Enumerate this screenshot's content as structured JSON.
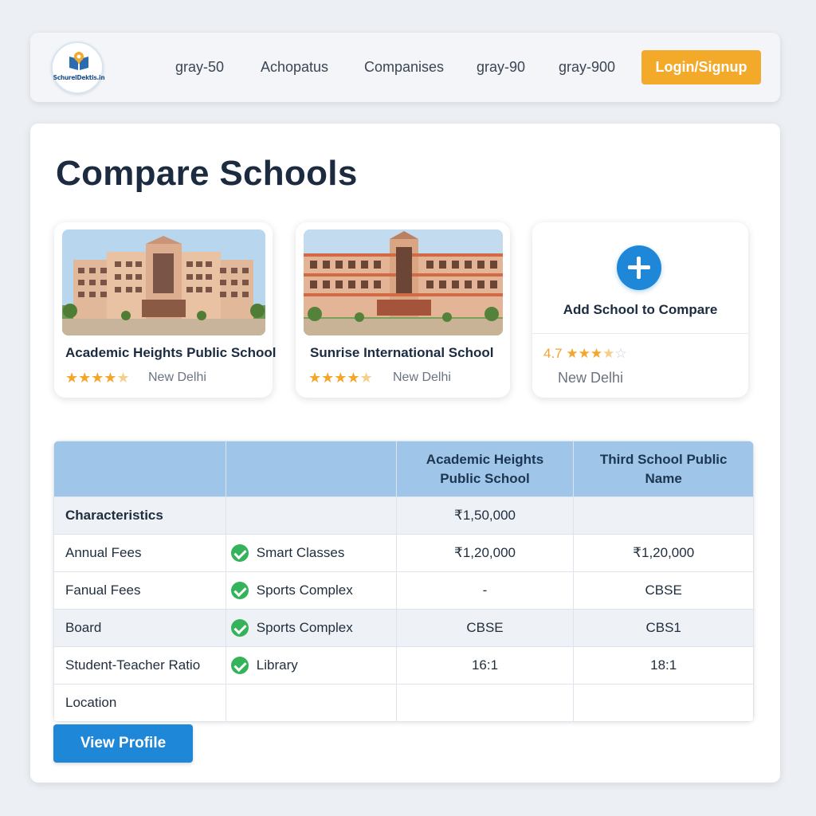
{
  "header": {
    "logo_text": "SchurelDektis.in",
    "nav": [
      "gray-50",
      "Achopatus",
      "Companises",
      "gray-90",
      "gray-900"
    ],
    "login_label": "Login/Signup",
    "accent_color": "#f3a929"
  },
  "page": {
    "title": "Compare Schools"
  },
  "schools": [
    {
      "name": "Academic Heights Public School",
      "stars": "★★★★",
      "half_star": "★",
      "rating_value": 4.5,
      "city": "New Delhi",
      "icon": "building-photo"
    },
    {
      "name": "Sunrise International School",
      "stars": "★★★★",
      "half_star": "★",
      "rating_value": 4.5,
      "city": "New Delhi",
      "icon": "building-photo"
    }
  ],
  "add_card": {
    "label": "Add School to Compare",
    "rating_number": "4.7",
    "stars": "★★★",
    "half_star": "★",
    "star_empty": "☆",
    "city": "New Delhi",
    "icon": "plus-icon"
  },
  "table": {
    "headers": [
      "",
      "",
      "Academic Heights Public School",
      "Third School Public Name"
    ],
    "header_color": "#9fc6e8",
    "rows": [
      {
        "label": "Characteristics",
        "bold": true,
        "feature": "",
        "col1": "₹1,50,000",
        "col2": ""
      },
      {
        "label": "Annual Fees",
        "bold": false,
        "feature": "Smart Classes",
        "col1": "₹1,20,000",
        "col2": "₹1,20,000"
      },
      {
        "label": "Fanual Fees",
        "bold": false,
        "feature": "Sports Complex",
        "col1": "-",
        "col2": "CBSE"
      },
      {
        "label": "Board",
        "bold": false,
        "feature": "Sports Complex",
        "col1": "CBSE",
        "col2": "CBS1"
      },
      {
        "label": "Student-Teacher Ratio",
        "bold": false,
        "feature": "Library",
        "col1": "16:1",
        "col2": "18:1"
      },
      {
        "label": "Location",
        "bold": false,
        "feature": "",
        "col1": "",
        "col2": ""
      }
    ]
  },
  "actions": {
    "view_profile": "View Profile",
    "primary_color": "#1f87d8",
    "check_color": "#34b35a"
  }
}
